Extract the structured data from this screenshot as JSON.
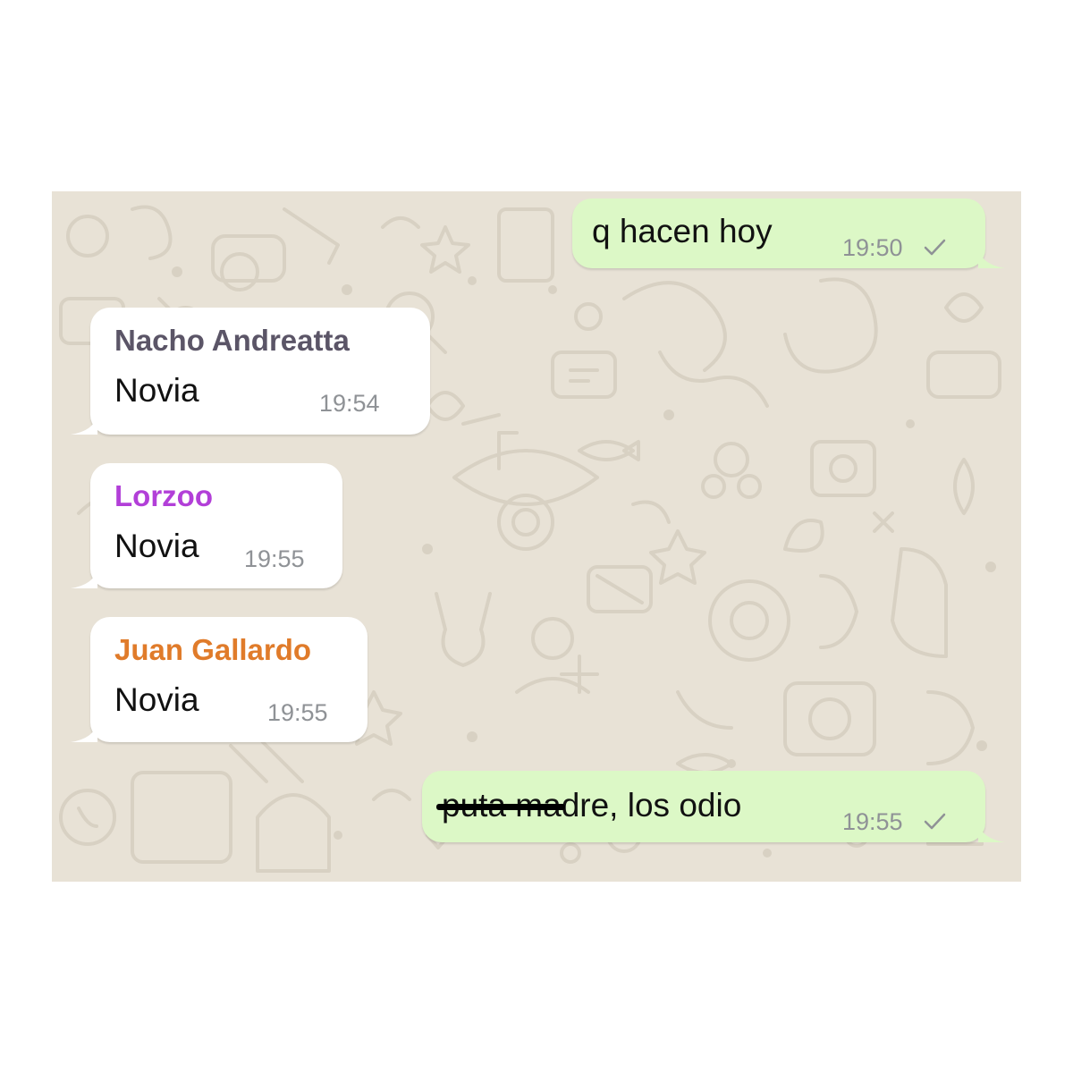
{
  "colors": {
    "background": "#e8e2d6",
    "incoming_bubble": "#ffffff",
    "outgoing_bubble": "#dcf8c6",
    "timestamp": "#8f9296",
    "read_check": "#8f9296"
  },
  "messages": [
    {
      "direction": "outgoing",
      "text": "q hacen hoy",
      "time": "19:50",
      "status_icon": "single-check-icon"
    },
    {
      "direction": "incoming",
      "sender": "Nacho Andreatta",
      "sender_color": "#5b5567",
      "text": "Novia",
      "time": "19:54"
    },
    {
      "direction": "incoming",
      "sender": "Lorzoo",
      "sender_color": "#b23fd8",
      "text": "Novia",
      "time": "19:55"
    },
    {
      "direction": "incoming",
      "sender": "Juan Gallardo",
      "sender_color": "#e07b2a",
      "text": "Novia",
      "time": "19:55"
    },
    {
      "direction": "outgoing",
      "text_struck": "puta ma",
      "text": "dre, los odio",
      "time": "19:55",
      "status_icon": "single-check-icon"
    }
  ]
}
